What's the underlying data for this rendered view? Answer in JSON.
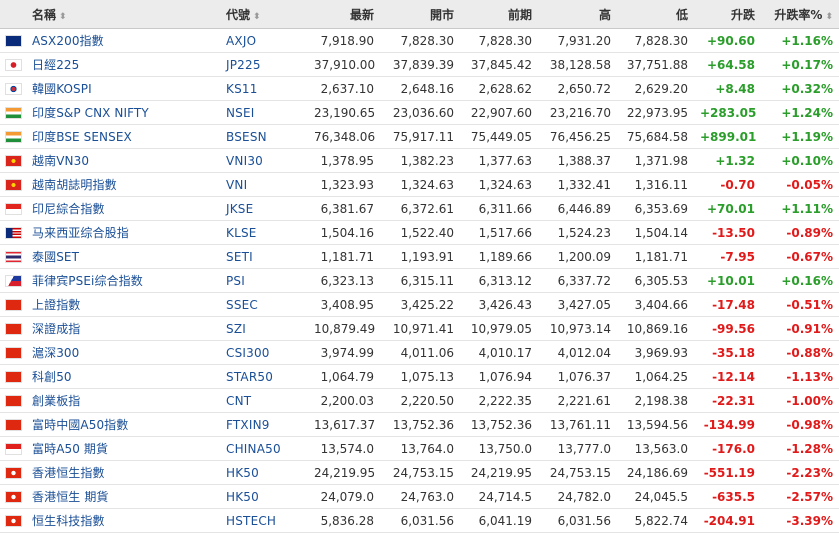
{
  "header": {
    "name": "名稱",
    "symbol": "代號",
    "last": "最新",
    "open": "開市",
    "prev": "前期",
    "high": "高",
    "low": "低",
    "change": "升跌",
    "change_pct": "升跌率%",
    "sort_glyph": "⬍"
  },
  "rows": [
    {
      "flag": "au",
      "name": "ASX200指數",
      "symbol": "AXJO",
      "last": "7,918.90",
      "open": "7,828.30",
      "prev": "7,828.30",
      "high": "7,931.20",
      "low": "7,828.30",
      "change": "+90.60",
      "change_pct": "+1.16%",
      "dir": "pos"
    },
    {
      "flag": "jp",
      "name": "日經225",
      "symbol": "JP225",
      "last": "37,910.00",
      "open": "37,839.39",
      "prev": "37,845.42",
      "high": "38,128.58",
      "low": "37,751.88",
      "change": "+64.58",
      "change_pct": "+0.17%",
      "dir": "pos"
    },
    {
      "flag": "kr",
      "name": "韓國KOSPI",
      "symbol": "KS11",
      "last": "2,637.10",
      "open": "2,648.16",
      "prev": "2,628.62",
      "high": "2,650.72",
      "low": "2,629.20",
      "change": "+8.48",
      "change_pct": "+0.32%",
      "dir": "pos"
    },
    {
      "flag": "in",
      "name": "印度S&P CNX NIFTY",
      "symbol": "NSEI",
      "last": "23,190.65",
      "open": "23,036.60",
      "prev": "22,907.60",
      "high": "23,216.70",
      "low": "22,973.95",
      "change": "+283.05",
      "change_pct": "+1.24%",
      "dir": "pos"
    },
    {
      "flag": "in",
      "name": "印度BSE SENSEX",
      "symbol": "BSESN",
      "last": "76,348.06",
      "open": "75,917.11",
      "prev": "75,449.05",
      "high": "76,456.25",
      "low": "75,684.58",
      "change": "+899.01",
      "change_pct": "+1.19%",
      "dir": "pos"
    },
    {
      "flag": "vn",
      "name": "越南VN30",
      "symbol": "VNI30",
      "last": "1,378.95",
      "open": "1,382.23",
      "prev": "1,377.63",
      "high": "1,388.37",
      "low": "1,371.98",
      "change": "+1.32",
      "change_pct": "+0.10%",
      "dir": "pos"
    },
    {
      "flag": "vn",
      "name": "越南胡誌明指數",
      "symbol": "VNI",
      "last": "1,323.93",
      "open": "1,324.63",
      "prev": "1,324.63",
      "high": "1,332.41",
      "low": "1,316.11",
      "change": "-0.70",
      "change_pct": "-0.05%",
      "dir": "neg"
    },
    {
      "flag": "id",
      "name": "印尼綜合指數",
      "symbol": "JKSE",
      "last": "6,381.67",
      "open": "6,372.61",
      "prev": "6,311.66",
      "high": "6,446.89",
      "low": "6,353.69",
      "change": "+70.01",
      "change_pct": "+1.11%",
      "dir": "pos"
    },
    {
      "flag": "my",
      "name": "马来西亚综合股指",
      "symbol": "KLSE",
      "last": "1,504.16",
      "open": "1,522.40",
      "prev": "1,517.66",
      "high": "1,524.23",
      "low": "1,504.14",
      "change": "-13.50",
      "change_pct": "-0.89%",
      "dir": "neg"
    },
    {
      "flag": "th",
      "name": "泰國SET",
      "symbol": "SETI",
      "last": "1,181.71",
      "open": "1,193.91",
      "prev": "1,189.66",
      "high": "1,200.09",
      "low": "1,181.71",
      "change": "-7.95",
      "change_pct": "-0.67%",
      "dir": "neg"
    },
    {
      "flag": "ph",
      "name": "菲律宾PSEi综合指数",
      "symbol": "PSI",
      "last": "6,323.13",
      "open": "6,315.11",
      "prev": "6,313.12",
      "high": "6,337.72",
      "low": "6,305.53",
      "change": "+10.01",
      "change_pct": "+0.16%",
      "dir": "pos"
    },
    {
      "flag": "cn",
      "name": "上證指數",
      "symbol": "SSEC",
      "last": "3,408.95",
      "open": "3,425.22",
      "prev": "3,426.43",
      "high": "3,427.05",
      "low": "3,404.66",
      "change": "-17.48",
      "change_pct": "-0.51%",
      "dir": "neg"
    },
    {
      "flag": "cn",
      "name": "深證成指",
      "symbol": "SZI",
      "last": "10,879.49",
      "open": "10,971.41",
      "prev": "10,979.05",
      "high": "10,973.14",
      "low": "10,869.16",
      "change": "-99.56",
      "change_pct": "-0.91%",
      "dir": "neg"
    },
    {
      "flag": "cn",
      "name": "滬深300",
      "symbol": "CSI300",
      "last": "3,974.99",
      "open": "4,011.06",
      "prev": "4,010.17",
      "high": "4,012.04",
      "low": "3,969.93",
      "change": "-35.18",
      "change_pct": "-0.88%",
      "dir": "neg"
    },
    {
      "flag": "cn",
      "name": "科創50",
      "symbol": "STAR50",
      "last": "1,064.79",
      "open": "1,075.13",
      "prev": "1,076.94",
      "high": "1,076.37",
      "low": "1,064.25",
      "change": "-12.14",
      "change_pct": "-1.13%",
      "dir": "neg"
    },
    {
      "flag": "cn",
      "name": "創業板指",
      "symbol": "CNT",
      "last": "2,200.03",
      "open": "2,220.50",
      "prev": "2,222.35",
      "high": "2,221.61",
      "low": "2,198.38",
      "change": "-22.31",
      "change_pct": "-1.00%",
      "dir": "neg"
    },
    {
      "flag": "cn",
      "name": "富時中國A50指數",
      "symbol": "FTXIN9",
      "last": "13,617.37",
      "open": "13,752.36",
      "prev": "13,752.36",
      "high": "13,761.11",
      "low": "13,594.56",
      "change": "-134.99",
      "change_pct": "-0.98%",
      "dir": "neg"
    },
    {
      "flag": "sg",
      "name": "富時A50 期貨",
      "symbol": "CHINA50",
      "last": "13,574.0",
      "open": "13,764.0",
      "prev": "13,750.0",
      "high": "13,777.0",
      "low": "13,563.0",
      "change": "-176.0",
      "change_pct": "-1.28%",
      "dir": "neg"
    },
    {
      "flag": "hk",
      "name": "香港恒生指數",
      "symbol": "HK50",
      "last": "24,219.95",
      "open": "24,753.15",
      "prev": "24,219.95",
      "high": "24,753.15",
      "low": "24,186.69",
      "change": "-551.19",
      "change_pct": "-2.23%",
      "dir": "neg"
    },
    {
      "flag": "hk",
      "name": "香港恒生 期貨",
      "symbol": "HK50",
      "last": "24,079.0",
      "open": "24,763.0",
      "prev": "24,714.5",
      "high": "24,782.0",
      "low": "24,045.5",
      "change": "-635.5",
      "change_pct": "-2.57%",
      "dir": "neg"
    },
    {
      "flag": "hk",
      "name": "恒生科技指數",
      "symbol": "HSTECH",
      "last": "5,836.28",
      "open": "6,031.56",
      "prev": "6,041.19",
      "high": "6,031.56",
      "low": "5,822.74",
      "change": "-204.91",
      "change_pct": "-3.39%",
      "dir": "neg"
    }
  ]
}
